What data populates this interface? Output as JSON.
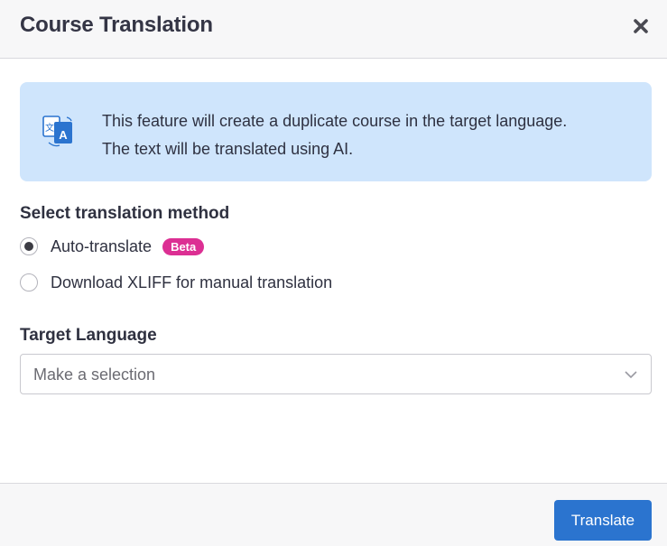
{
  "dialog": {
    "title": "Course Translation",
    "close_icon": "close-icon"
  },
  "info": {
    "icon": "translate-icon",
    "line1": "This feature will create a duplicate course in the target language.",
    "line2": "The text will be translated using AI."
  },
  "method": {
    "label": "Select translation method",
    "options": [
      {
        "label": "Auto-translate",
        "badge": "Beta",
        "selected": true
      },
      {
        "label": "Download XLIFF for manual translation",
        "selected": false
      }
    ]
  },
  "target_language": {
    "label": "Target Language",
    "placeholder": "Make a selection"
  },
  "footer": {
    "translate_label": "Translate"
  },
  "colors": {
    "accent": "#2b74cf",
    "info_bg": "#cfe5fc",
    "badge": "#dc2f93"
  }
}
